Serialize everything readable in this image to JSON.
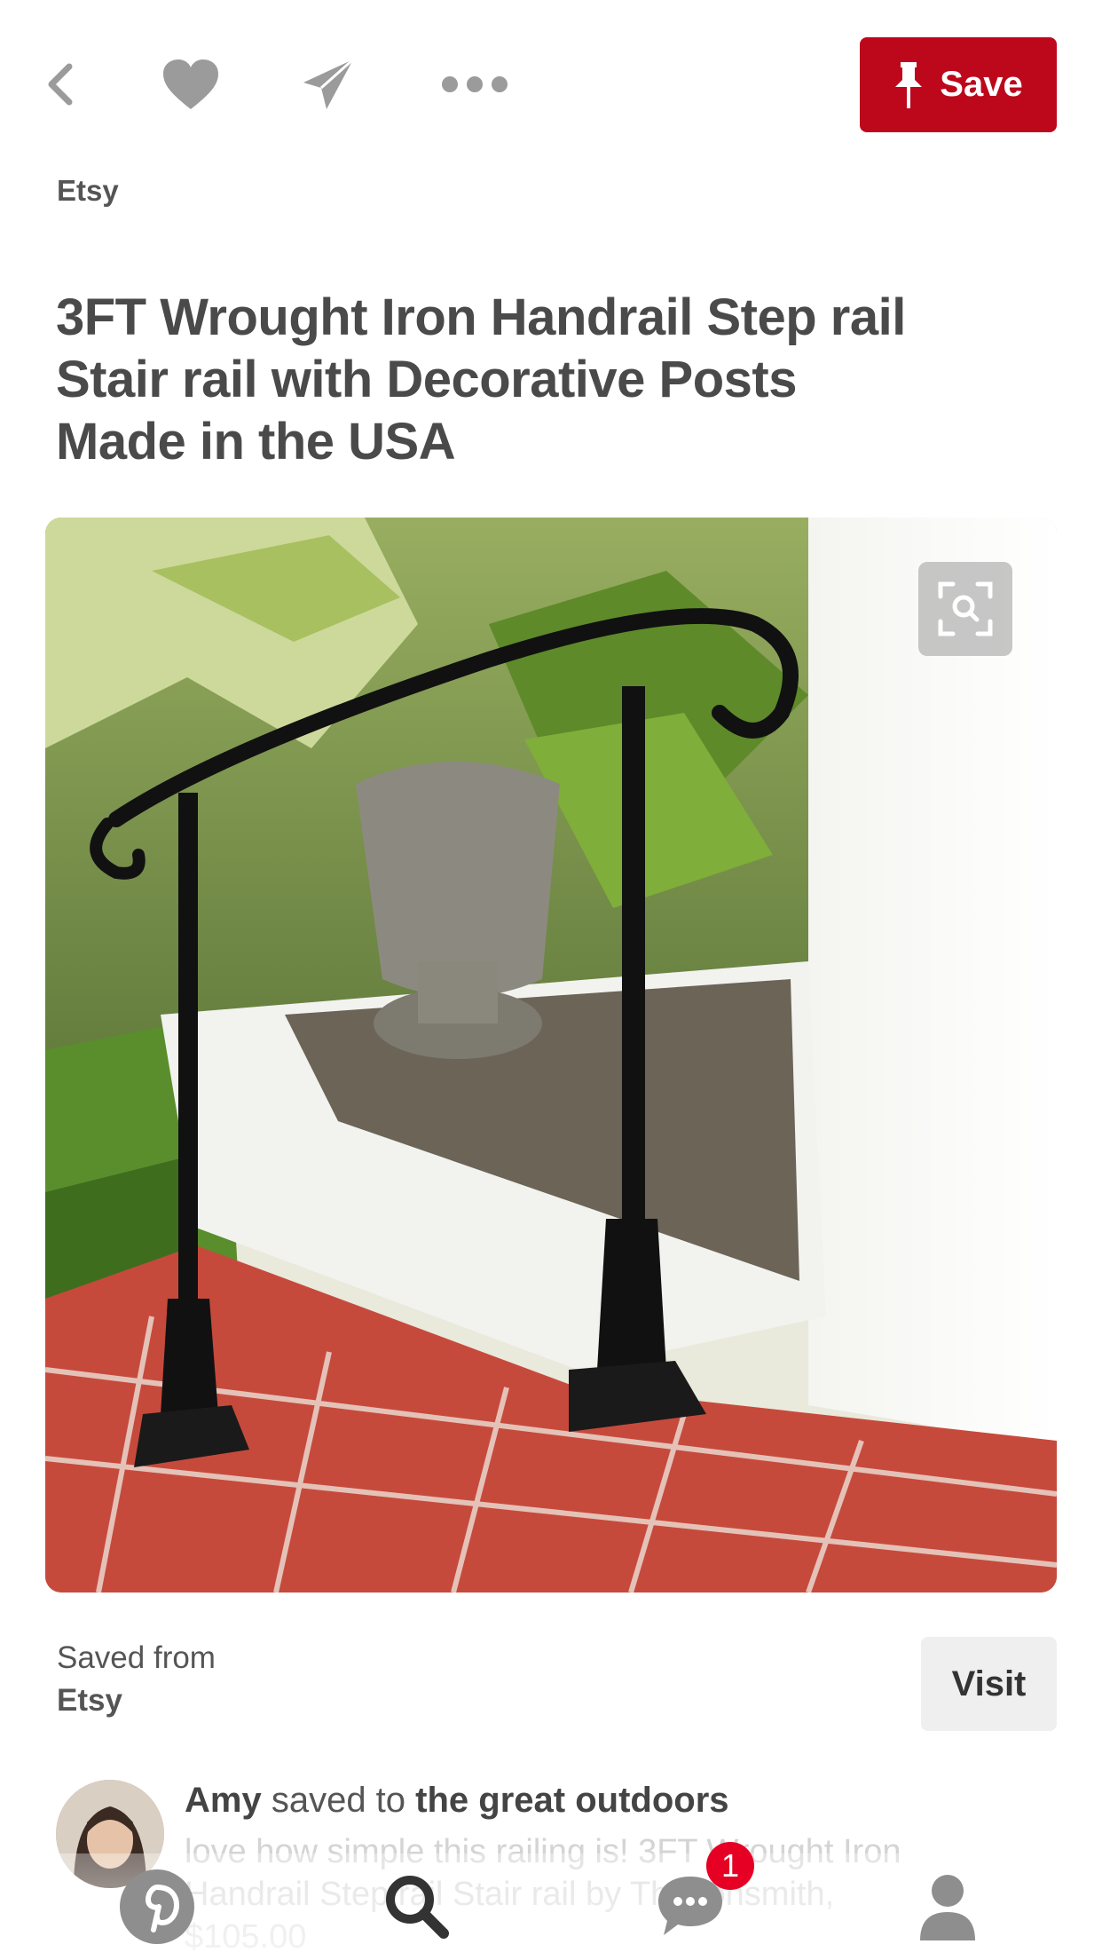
{
  "toolbar": {
    "back_icon": "chevron-left-icon",
    "like_icon": "heart-icon",
    "send_icon": "paper-plane-icon",
    "more_icon": "ellipsis-icon",
    "save_icon": "pushpin-icon",
    "save_label": "Save",
    "save_color": "#bd081c"
  },
  "pin": {
    "source": "Etsy",
    "title": "3FT Wrought Iron Handrail Step rail Stair rail with Decorative Posts Made in the USA",
    "image_description_icon": "visual-search-icon"
  },
  "saved_from": {
    "label": "Saved from",
    "domain": "Etsy",
    "visit_label": "Visit"
  },
  "activity": {
    "user": "Amy",
    "action": "saved to",
    "board": "the great outdoors",
    "description": "love how simple this railing is! 3FT Wrought Iron Handrail Step rail Stair rail by Theironsmith, $105.00"
  },
  "bottom_nav": {
    "items": [
      {
        "name": "home",
        "icon": "pinterest-logo-icon"
      },
      {
        "name": "search",
        "icon": "search-icon"
      },
      {
        "name": "messages",
        "icon": "chat-bubble-icon",
        "badge": "1"
      },
      {
        "name": "profile",
        "icon": "person-icon"
      }
    ]
  }
}
